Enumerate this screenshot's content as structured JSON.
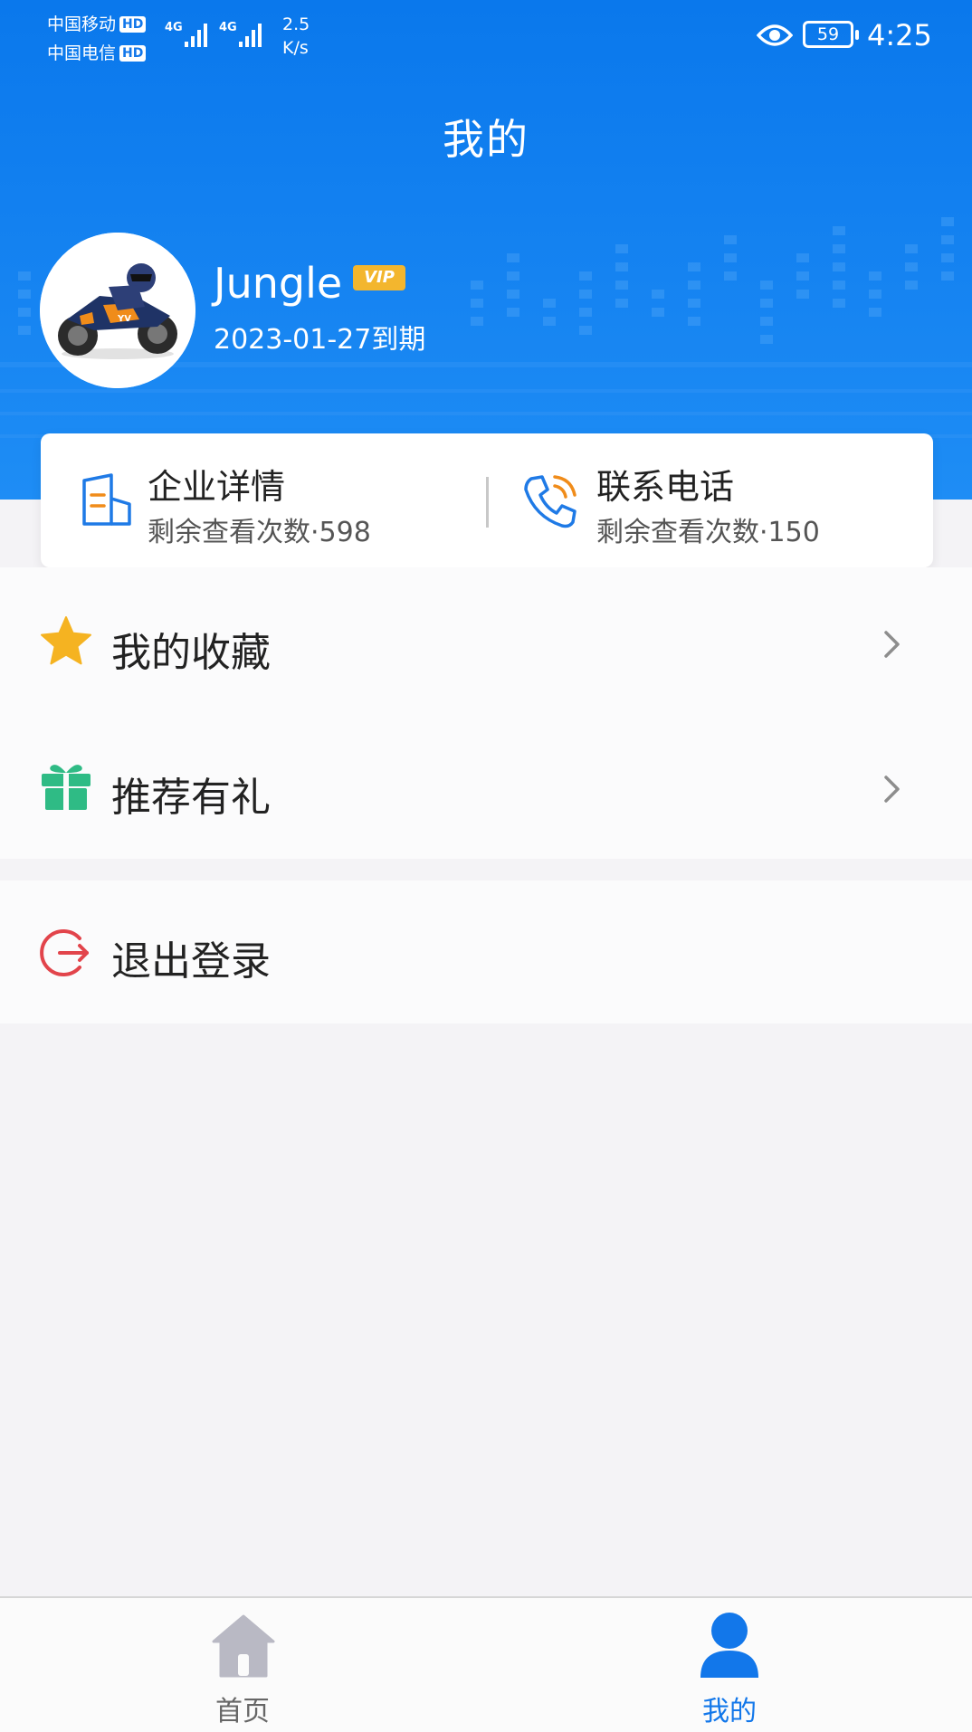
{
  "status_bar": {
    "carrier_1": "中国移动",
    "carrier_2": "中国电信",
    "hd_badge": "HD",
    "net_type": "4G",
    "speed_value": "2.5",
    "speed_unit": "K/s",
    "battery": "59",
    "time": "4:25"
  },
  "header": {
    "title": "我的"
  },
  "profile": {
    "username": "Jungle",
    "vip_badge": "VIP",
    "expiry": "2023-01-27到期"
  },
  "quota": {
    "company": {
      "title": "企业详情",
      "subtitle": "剩余查看次数·598"
    },
    "phone": {
      "title": "联系电话",
      "subtitle": "剩余查看次数·150"
    }
  },
  "menu": {
    "favorites": "我的收藏",
    "referral": "推荐有礼",
    "logout": "退出登录"
  },
  "tabbar": {
    "home": "首页",
    "mine": "我的"
  },
  "colors": {
    "primary": "#1277ea",
    "star": "#f5b321",
    "gift": "#2fbb85",
    "logout": "#e2444b",
    "tab_inactive": "#b9b9c4"
  }
}
